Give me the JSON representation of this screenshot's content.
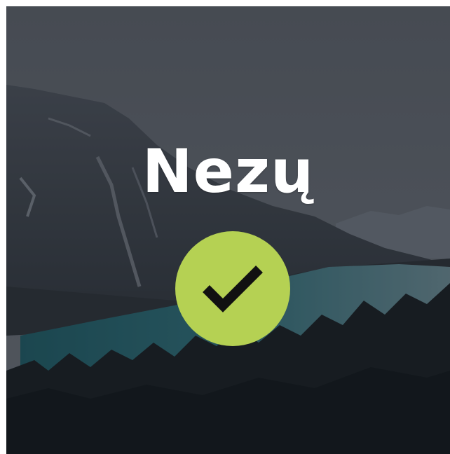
{
  "title": "Nezų",
  "colors": {
    "accent": "#b5d153",
    "check": "#111111",
    "title": "#ffffff",
    "overlay": "#1e232a"
  },
  "icons": {
    "background": "mountain-lake-landscape",
    "status": "checkmark-icon"
  }
}
